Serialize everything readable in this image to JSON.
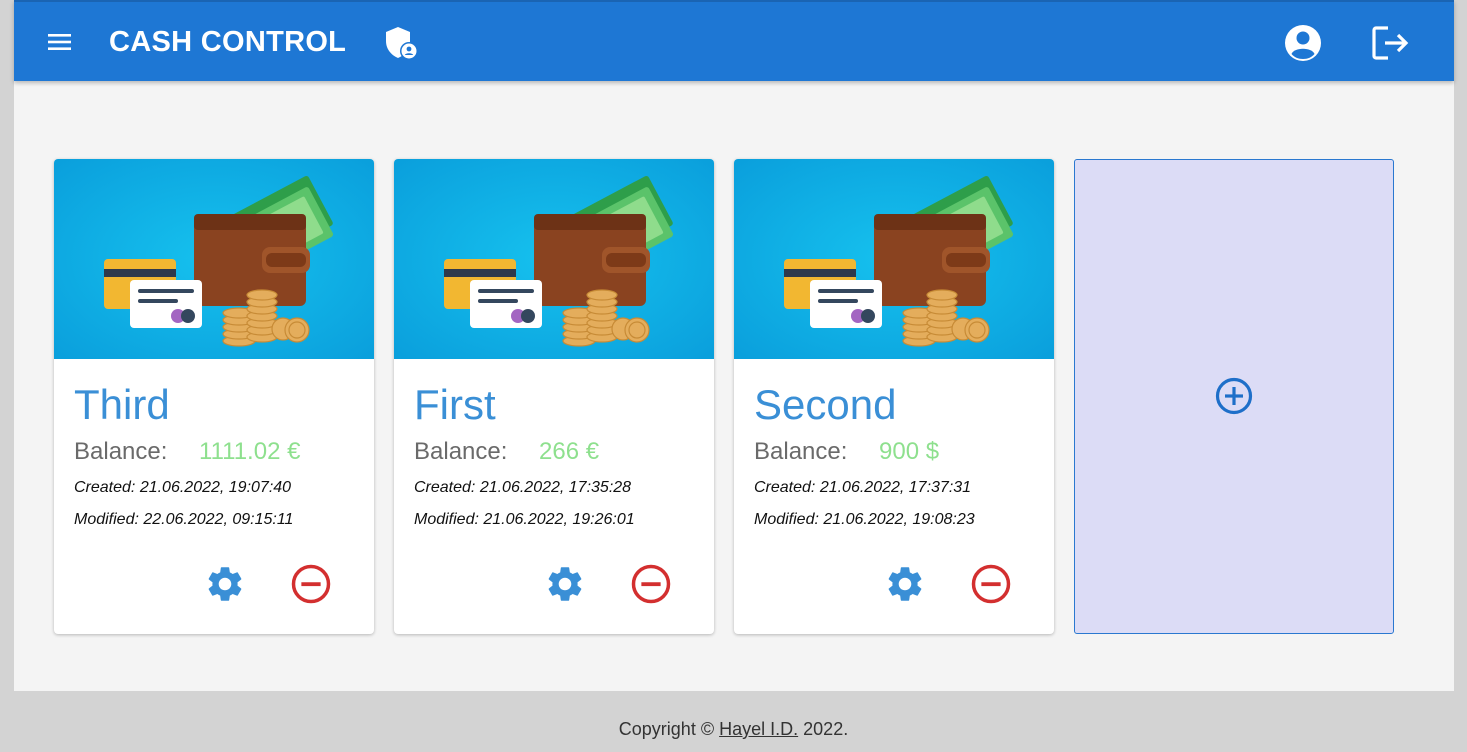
{
  "header": {
    "title": "CASH CONTROL",
    "menu_icon": "menu-icon",
    "shield_icon": "admin-shield-icon",
    "account_icon": "account-circle-icon",
    "logout_icon": "logout-icon",
    "color": "#1e77d4"
  },
  "wallets": [
    {
      "name": "Third",
      "balance_label": "Balance:",
      "balance": "1111.02 €",
      "created": "Created: 21.06.2022, 19:07:40",
      "modified": "Modified: 22.06.2022, 09:15:11"
    },
    {
      "name": "First",
      "balance_label": "Balance:",
      "balance": "266 €",
      "created": "Created: 21.06.2022, 17:35:28",
      "modified": "Modified: 21.06.2022, 19:26:01"
    },
    {
      "name": "Second",
      "balance_label": "Balance:",
      "balance": "900 $",
      "created": "Created: 21.06.2022, 17:37:31",
      "modified": "Modified: 21.06.2022, 19:08:23"
    }
  ],
  "add_wallet": {
    "icon": "add-circle-icon"
  },
  "colors": {
    "wallet_name": "#3a8fd6",
    "balance_value": "#8ee08e",
    "settings": "#3a8fd6",
    "delete": "#d32f2f",
    "add_card_bg": "#dcdcf6"
  },
  "footer": {
    "prefix": "Copyright ©",
    "author": "Hayel I.D.",
    "suffix": "2022."
  }
}
